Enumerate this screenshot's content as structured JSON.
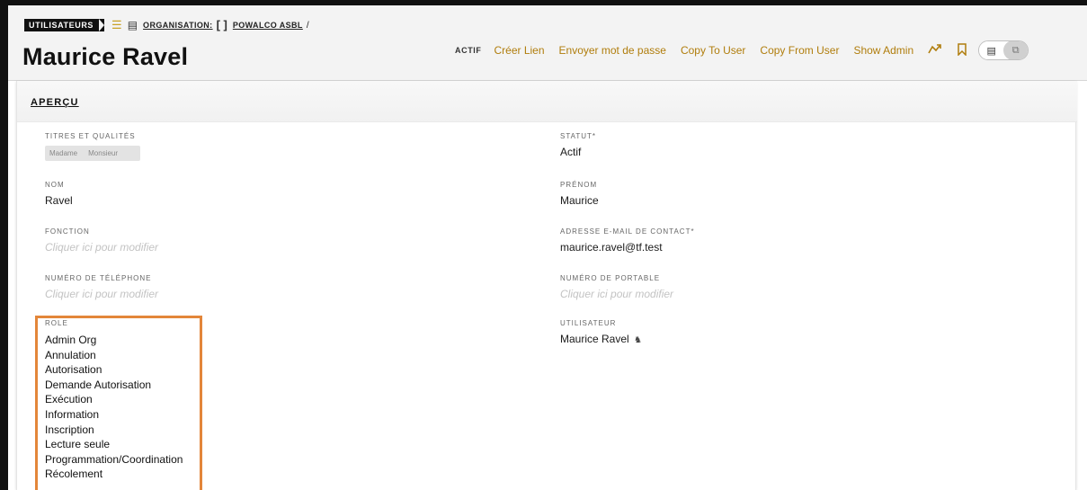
{
  "breadcrumb": {
    "tag": "UTILISATEURS",
    "org_label": "ORGANISATION:",
    "org_name": "POWALCO ASBL",
    "separator": "/"
  },
  "header": {
    "title": "Maurice Ravel",
    "status": "ACTIF",
    "actions": [
      "Créer Lien",
      "Envoyer mot de passe",
      "Copy To User",
      "Copy From User",
      "Show Admin"
    ]
  },
  "section": {
    "title": "APERÇU"
  },
  "fields": {
    "titres": {
      "label": "TITRES ET QUALITÉS",
      "options": [
        "Madame",
        "Monsieur"
      ]
    },
    "statut": {
      "label": "STATUT*",
      "value": "Actif"
    },
    "nom": {
      "label": "NOM",
      "value": "Ravel"
    },
    "prenom": {
      "label": "PRÉNOM",
      "value": "Maurice"
    },
    "fonction": {
      "label": "FONCTION",
      "placeholder": "Cliquer ici pour modifier"
    },
    "email": {
      "label": "ADRESSE E-MAIL DE CONTACT*",
      "value": "maurice.ravel@tf.test"
    },
    "telephone": {
      "label": "NUMÉRO DE TÉLÉPHONE",
      "placeholder": "Cliquer ici pour modifier"
    },
    "portable": {
      "label": "NUMÉRO DE PORTABLE",
      "placeholder": "Cliquer ici pour modifier"
    },
    "role": {
      "label": "ROLE",
      "items": [
        "Admin Org",
        "Annulation",
        "Autorisation",
        "Demande Autorisation",
        "Exécution",
        "Information",
        "Inscription",
        "Lecture seule",
        "Programmation/Coordination",
        "Récolement"
      ]
    },
    "utilisateur": {
      "label": "UTILISATEUR",
      "value": "Maurice Ravel"
    }
  },
  "colors": {
    "accent": "#b07d0c",
    "highlight": "#e3863a"
  },
  "icons": {
    "list": "list-icon",
    "document": "document-icon",
    "share": "share-icon",
    "bookmark": "bookmark-icon",
    "user": "user-icon"
  }
}
